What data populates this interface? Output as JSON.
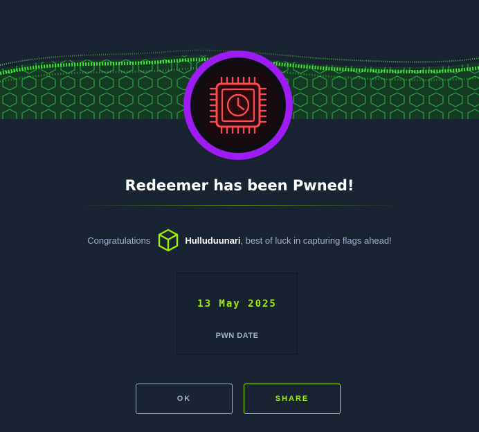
{
  "modal": {
    "title": "Redeemer has been Pwned!",
    "congrats_prefix": "Congratulations",
    "username": "Hulluduunari",
    "congrats_suffix": ", best of luck in capturing flags ahead!",
    "pwn_date": "13 May 2025",
    "pwn_date_label": "PWN DATE",
    "ok_label": "OK",
    "share_label": "SHARE"
  },
  "icons": {
    "banner": "green-hex-wave-banner",
    "badge": "machine-chip-clock-icon",
    "user_rank": "green-cube-icon"
  },
  "colors": {
    "background": "#1a2332",
    "accent_green": "#9fef00",
    "badge_ring": "#9c1cf3",
    "chip_red": "#ff3e3e",
    "muted_text": "#a4b1cd"
  }
}
